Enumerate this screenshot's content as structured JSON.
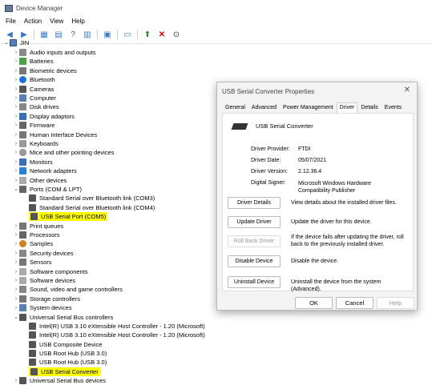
{
  "window": {
    "title": "Device Manager"
  },
  "menu": [
    "File",
    "Action",
    "View",
    "Help"
  ],
  "tree": {
    "root": "JIN",
    "items": [
      "Audio inputs and outputs",
      "Batteries",
      "Biometric devices",
      "Bluetooth",
      "Cameras",
      "Computer",
      "Disk drives",
      "Display adaptors",
      "Firmware",
      "Human Interface Devices",
      "Keyboards",
      "Mice and other pointing devices",
      "Monitors",
      "Network adapters",
      "Other devices",
      "Ports (COM & LPT)",
      "Standard Serial over Bluetooth link (COM3)",
      "Standard Serial over Bluetooth link (COM4)",
      "USB Serial Port (COM5)",
      "Print queues",
      "Processors",
      "Samples",
      "Security devices",
      "Sensors",
      "Software components",
      "Software devices",
      "Sound, video and game controllers",
      "Storage controllers",
      "System devices",
      "Universal Serial Bus controllers",
      "Intel(R) USB 3.10 eXtensible Host Controller - 1.20 (Microsoft)",
      "Intel(R) USB 3.10 eXtensible Host Controller - 1.20 (Microsoft)",
      "USB Composite Device",
      "USB Root Hub (USB 3.0)",
      "USB Root Hub (USB 3.0)",
      "USB Serial Converter",
      "Universal Serial Bus devices"
    ]
  },
  "dialog": {
    "title": "USB Serial Converter Properties",
    "close": "✕",
    "tabs": [
      "General",
      "Advanced",
      "Power Management",
      "Driver",
      "Details",
      "Events"
    ],
    "device_name": "USB Serial Converter",
    "fields": {
      "provider_label": "Driver Provider:",
      "provider_value": "FTDI",
      "date_label": "Driver Date:",
      "date_value": "05/07/2021",
      "version_label": "Driver Version:",
      "version_value": "2.12.36.4",
      "signer_label": "Digital Signer:",
      "signer_value": "Microsoft Windows Hardware Compatibility Publisher"
    },
    "actions": [
      {
        "label": "Driver Details",
        "desc": "View details about the installed driver files."
      },
      {
        "label": "Update Driver",
        "desc": "Update the driver for this device."
      },
      {
        "label": "Roll Back Driver",
        "desc": "If the device fails after updating the driver, roll back to the previously installed driver."
      },
      {
        "label": "Disable Device",
        "desc": "Disable the device."
      },
      {
        "label": "Uninstall Device",
        "desc": "Uninstall the device from the system (Advanced)."
      }
    ],
    "ok": "OK",
    "cancel": "Cancel",
    "help": "Help"
  }
}
